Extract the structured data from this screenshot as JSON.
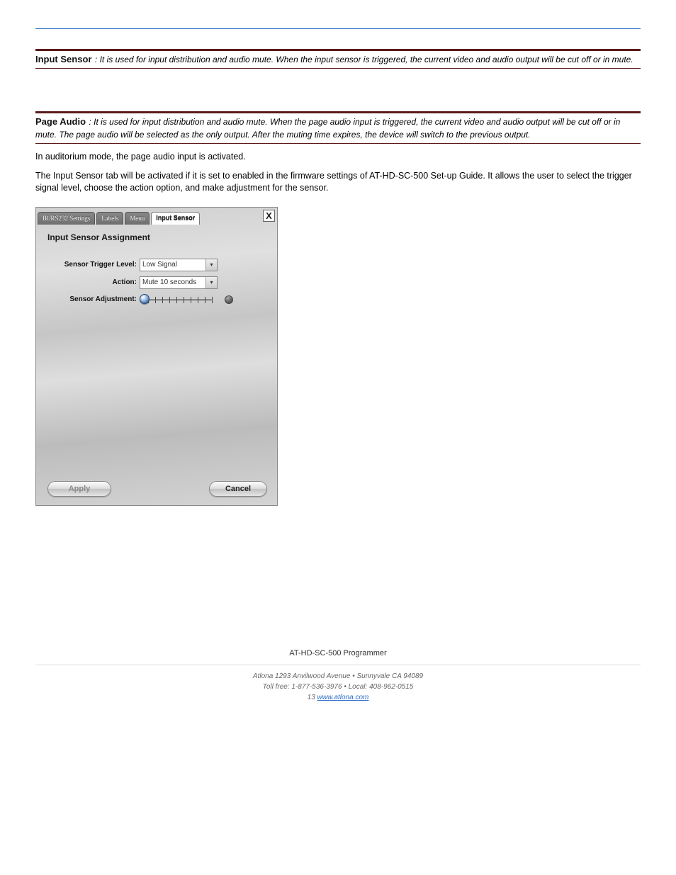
{
  "rules": {},
  "section1": {
    "title": "Input Sensor",
    "desc": "It is used for input distribution and audio mute. When the input sensor is triggered, the current video and audio output will be cut off or in mute."
  },
  "section2": {
    "title": "Page Audio",
    "desc": "It is used for input distribution and audio mute. When the page audio input is triggered, the current video and audio output will be cut off or in mute. The page audio will be selected as the only output. After the muting time expires, the device will switch to the previous output."
  },
  "paras": {
    "p1": "In auditorium mode, the page audio input is activated.",
    "p2": "The Input Sensor tab will be activated if it is set to enabled in the firmware settings of AT-HD-SC-500 Set-up Guide. It allows the user to select the trigger signal level, choose the action option, and make adjustment for the sensor."
  },
  "screenshot": {
    "tabs": [
      "IR/RS232 Settings",
      "Labels",
      "Menu",
      "Input Sensor"
    ],
    "close": "X",
    "panel_title": "Input Sensor Assignment",
    "row_trigger": {
      "label": "Sensor Trigger Level:",
      "value": "Low Signal"
    },
    "row_action": {
      "label": "Action:",
      "value": "Mute 10 seconds"
    },
    "row_adjust": {
      "label": "Sensor Adjustment:"
    },
    "apply": "Apply",
    "cancel": "Cancel"
  },
  "footer": {
    "line1": "AT-HD-SC-500 Programmer",
    "addr": "Atlona 1293 Anvilwood Avenue • Sunnyvale CA 94089",
    "toll": "Toll free: 1-877-536-3976 • Local: 408-962-0515",
    "page": "www.atlona.com",
    "url": "www.atlona.com"
  }
}
